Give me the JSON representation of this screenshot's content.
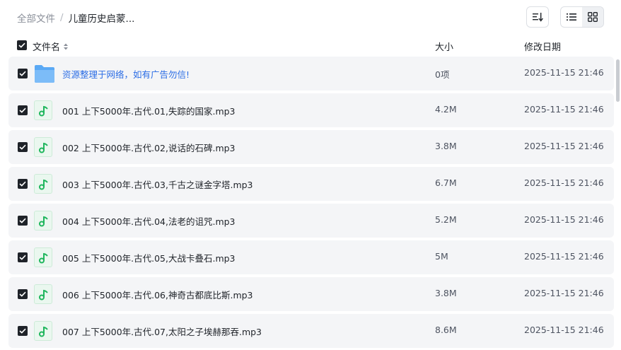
{
  "breadcrumb": {
    "root": "全部文件",
    "separator": "/",
    "current": "儿童历史启蒙..."
  },
  "toolbar": {
    "sort_icon": "sort-icon",
    "list_view_icon": "list-view-icon",
    "grid_view_icon": "grid-view-icon",
    "active_view": "list"
  },
  "columns": {
    "name": "文件名",
    "size": "大小",
    "date": "修改日期"
  },
  "colors": {
    "accent": "#2b6de5",
    "audio": "#1fb65d",
    "folder": "#5aa9f5"
  },
  "rows": [
    {
      "icon": "folder-icon",
      "name": "资源整理于网络，如有广告勿信!",
      "size": "0项",
      "date": "2025-11-15 21:46",
      "checked": true
    },
    {
      "icon": "audio-file-icon",
      "name": "001 上下5000年.古代.01,失踪的国家.mp3",
      "size": "4.2M",
      "date": "2025-11-15 21:46",
      "checked": true
    },
    {
      "icon": "audio-file-icon",
      "name": "002 上下5000年.古代.02,说话的石碑.mp3",
      "size": "3.8M",
      "date": "2025-11-15 21:46",
      "checked": true
    },
    {
      "icon": "audio-file-icon",
      "name": "003 上下5000年.古代.03,千古之谜金字塔.mp3",
      "size": "6.7M",
      "date": "2025-11-15 21:46",
      "checked": true
    },
    {
      "icon": "audio-file-icon",
      "name": "004 上下5000年.古代.04,法老的诅咒.mp3",
      "size": "5.2M",
      "date": "2025-11-15 21:46",
      "checked": true
    },
    {
      "icon": "audio-file-icon",
      "name": "005 上下5000年.古代.05,大战卡叠石.mp3",
      "size": "5M",
      "date": "2025-11-15 21:46",
      "checked": true
    },
    {
      "icon": "audio-file-icon",
      "name": "006 上下5000年.古代.06,神奇古都底比斯.mp3",
      "size": "3.8M",
      "date": "2025-11-15 21:46",
      "checked": true
    },
    {
      "icon": "audio-file-icon",
      "name": "007 上下5000年.古代.07,太阳之子埃赫那吞.mp3",
      "size": "8.6M",
      "date": "2025-11-15 21:46",
      "checked": true
    }
  ]
}
